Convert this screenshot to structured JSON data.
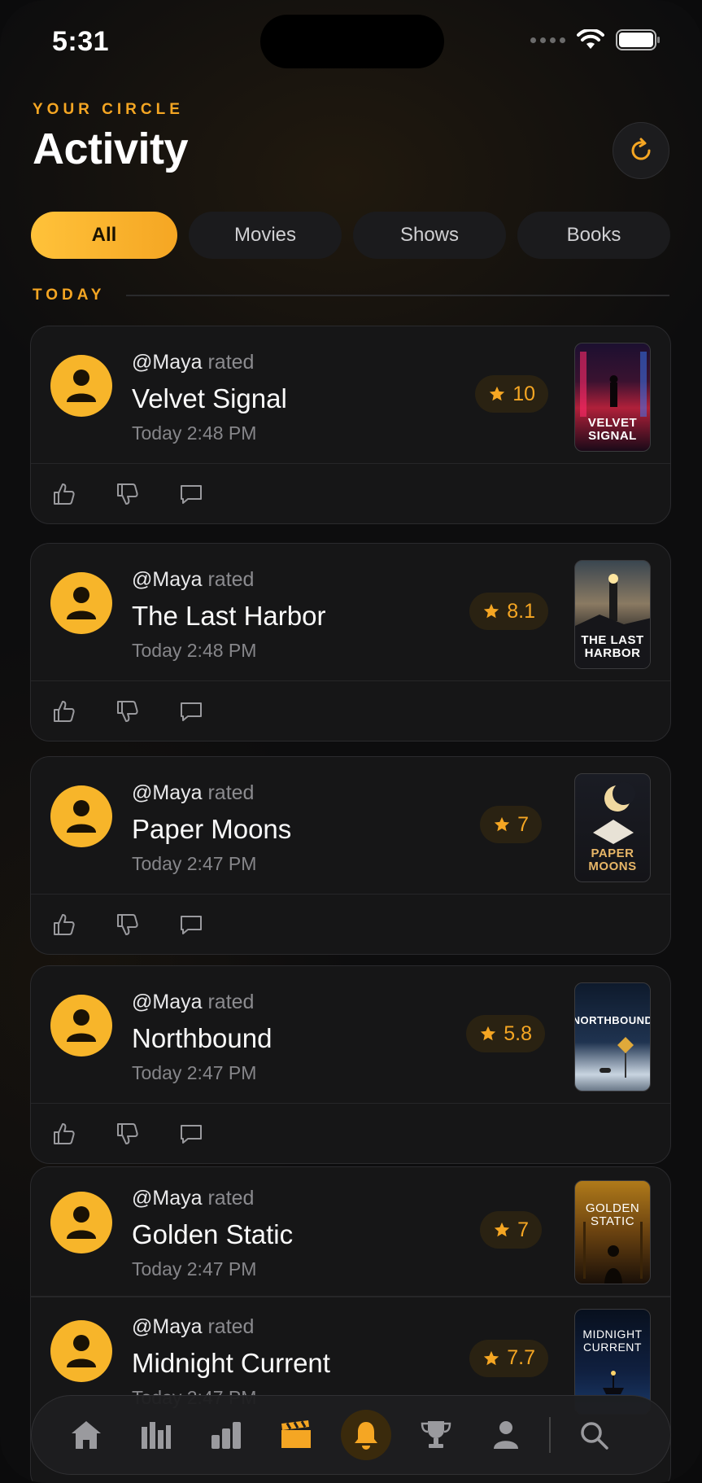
{
  "status_bar": {
    "time": "5:31"
  },
  "header": {
    "eyebrow": "YOUR CIRCLE",
    "title": "Activity"
  },
  "filters": [
    {
      "label": "All",
      "active": true
    },
    {
      "label": "Movies",
      "active": false
    },
    {
      "label": "Shows",
      "active": false
    },
    {
      "label": "Books",
      "active": false
    }
  ],
  "section": {
    "label": "TODAY"
  },
  "activities": [
    {
      "user": "@Maya",
      "verb": "rated",
      "title": "Velvet Signal",
      "time": "Today 2:48 PM",
      "rating": "10",
      "poster_text": "VELVET SIGNAL"
    },
    {
      "user": "@Maya",
      "verb": "rated",
      "title": "The Last Harbor",
      "time": "Today 2:48 PM",
      "rating": "8.1",
      "poster_text": "THE LAST HARBOR"
    },
    {
      "user": "@Maya",
      "verb": "rated",
      "title": "Paper Moons",
      "time": "Today 2:47 PM",
      "rating": "7",
      "poster_text": "PAPER MOONS"
    },
    {
      "user": "@Maya",
      "verb": "rated",
      "title": "Northbound",
      "time": "Today 2:47 PM",
      "rating": "5.8",
      "poster_text": "NORTHBOUND"
    },
    {
      "user": "@Maya",
      "verb": "rated",
      "title": "Golden Static",
      "time": "Today 2:47 PM",
      "rating": "7",
      "poster_text": "GOLDEN STATIC"
    },
    {
      "user": "@Maya",
      "verb": "rated",
      "title": "Midnight Current",
      "time": "Today 2:47 PM",
      "rating": "7.7",
      "poster_text": "MIDNIGHT CURRENT"
    }
  ],
  "tab_bar": {
    "tabs": [
      "home-icon",
      "library-icon",
      "stats-icon",
      "clapperboard-icon",
      "bell-icon",
      "trophy-icon",
      "profile-icon",
      "search-icon"
    ],
    "active": "bell-icon"
  },
  "colors": {
    "accent": "#f5a623",
    "background": "#0d0d0e",
    "card": "#161617"
  }
}
